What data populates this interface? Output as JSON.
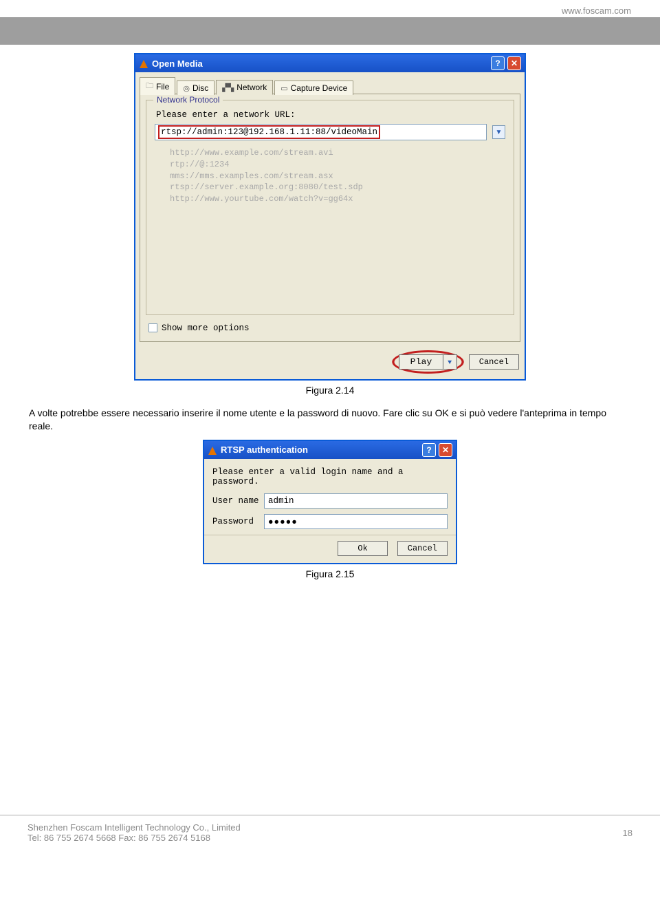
{
  "header_url": "www.foscam.com",
  "open_media": {
    "title": "Open Media",
    "tabs": {
      "file": "File",
      "disc": "Disc",
      "network": "Network",
      "capture": "Capture Device"
    },
    "fieldset_legend": "Network Protocol",
    "prompt": "Please enter a network URL:",
    "url_value": "rtsp://admin:123@192.168.1.11:88/videoMain",
    "examples": [
      "http://www.example.com/stream.avi",
      "rtp://@:1234",
      "mms://mms.examples.com/stream.asx",
      "rtsp://server.example.org:8080/test.sdp",
      "http://www.yourtube.com/watch?v=gg64x"
    ],
    "more_options": "Show more options",
    "play": "Play",
    "cancel": "Cancel"
  },
  "caption_214": "Figura 2.14",
  "paragraph": "A volte potrebbe essere necessario inserire il nome utente e la password di nuovo. Fare clic su OK e si può vedere l'anteprima in tempo reale.",
  "auth": {
    "title": "RTSP authentication",
    "prompt": "Please enter a valid login name and a password.",
    "user_label": "User name",
    "user_value": "admin",
    "pass_label": "Password",
    "pass_value": "●●●●●",
    "ok": "Ok",
    "cancel": "Cancel"
  },
  "caption_215": "Figura 2.15",
  "footer": {
    "company": "Shenzhen Foscam Intelligent Technology Co., Limited",
    "tel": "Tel: 86 755 2674 5668 Fax: 86 755 2674 5168",
    "page_no": "18"
  }
}
